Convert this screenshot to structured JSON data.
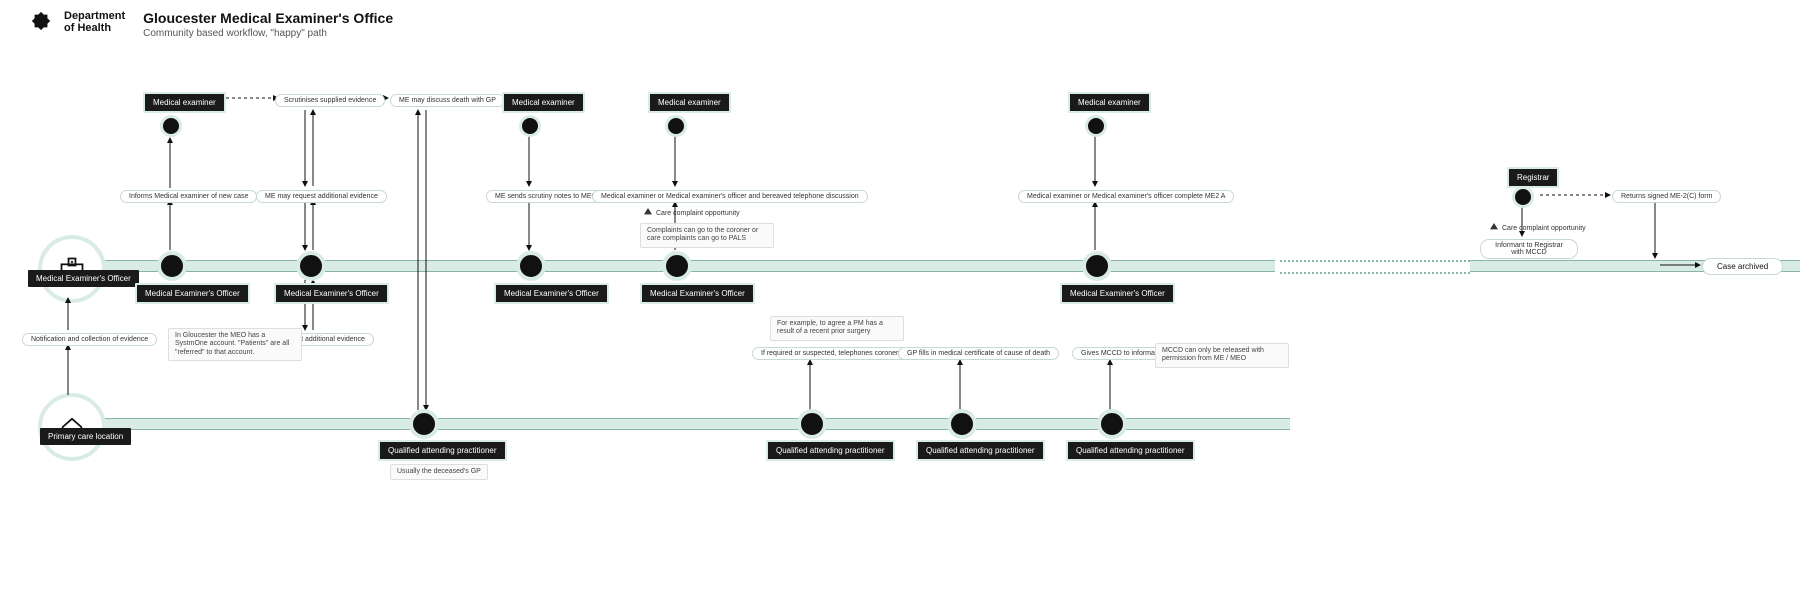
{
  "header": {
    "dept_line1": "Department",
    "dept_line2": "of Health",
    "title": "Gloucester Medical Examiner's Office",
    "subtitle": "Community based workflow, \"happy\" path"
  },
  "lanes": {
    "meo": {
      "label": "Medical Examiner's Officer"
    },
    "primary": {
      "label": "Primary care location"
    }
  },
  "roles": {
    "me": "Medical examiner",
    "meo": "Medical Examiner's Officer",
    "qap": "Qualified attending practitioner",
    "registrar": "Registrar"
  },
  "messages": {
    "m1": "Notification and collection of evidence",
    "m2": "Informs Medical examiner of new case",
    "m3": "Scrutinises supplied evidence",
    "m4": "ME may request additional evidence",
    "m5": "Request additional evidence",
    "m6": "ME may discuss death with GP",
    "m7": "ME sends scrutiny notes to MEO",
    "m8": "Medical examiner or Medical examiner's officer and bereaved telephone discussion",
    "m9": "If required or suspected, telephones coroner's office",
    "m10": "GP fills in medical certificate of cause of death",
    "m11": "Gives MCCD to informant",
    "m12": "Medical examiner or Medical examiner's officer complete ME2 A",
    "m13": "Informant to Registrar with MCCD",
    "m14": "Returns signed ME-2(C) form",
    "end": "Case archived"
  },
  "notes": {
    "n1": "In Gloucester the MEO has a SystmOne account. \"Patients\" are all \"referred\" to that account.",
    "n2": "Usually the deceased's GP",
    "n3": "For example, to agree a PM has a result of a recent prior surgery",
    "n4": "MCCD can only be released with permission from ME / MEO",
    "n5": "Complaints can go to the coroner or care complaints can go to PALS"
  },
  "care": {
    "c1": "Care complaint opportunity",
    "c2": "Care complaint opportunity"
  }
}
